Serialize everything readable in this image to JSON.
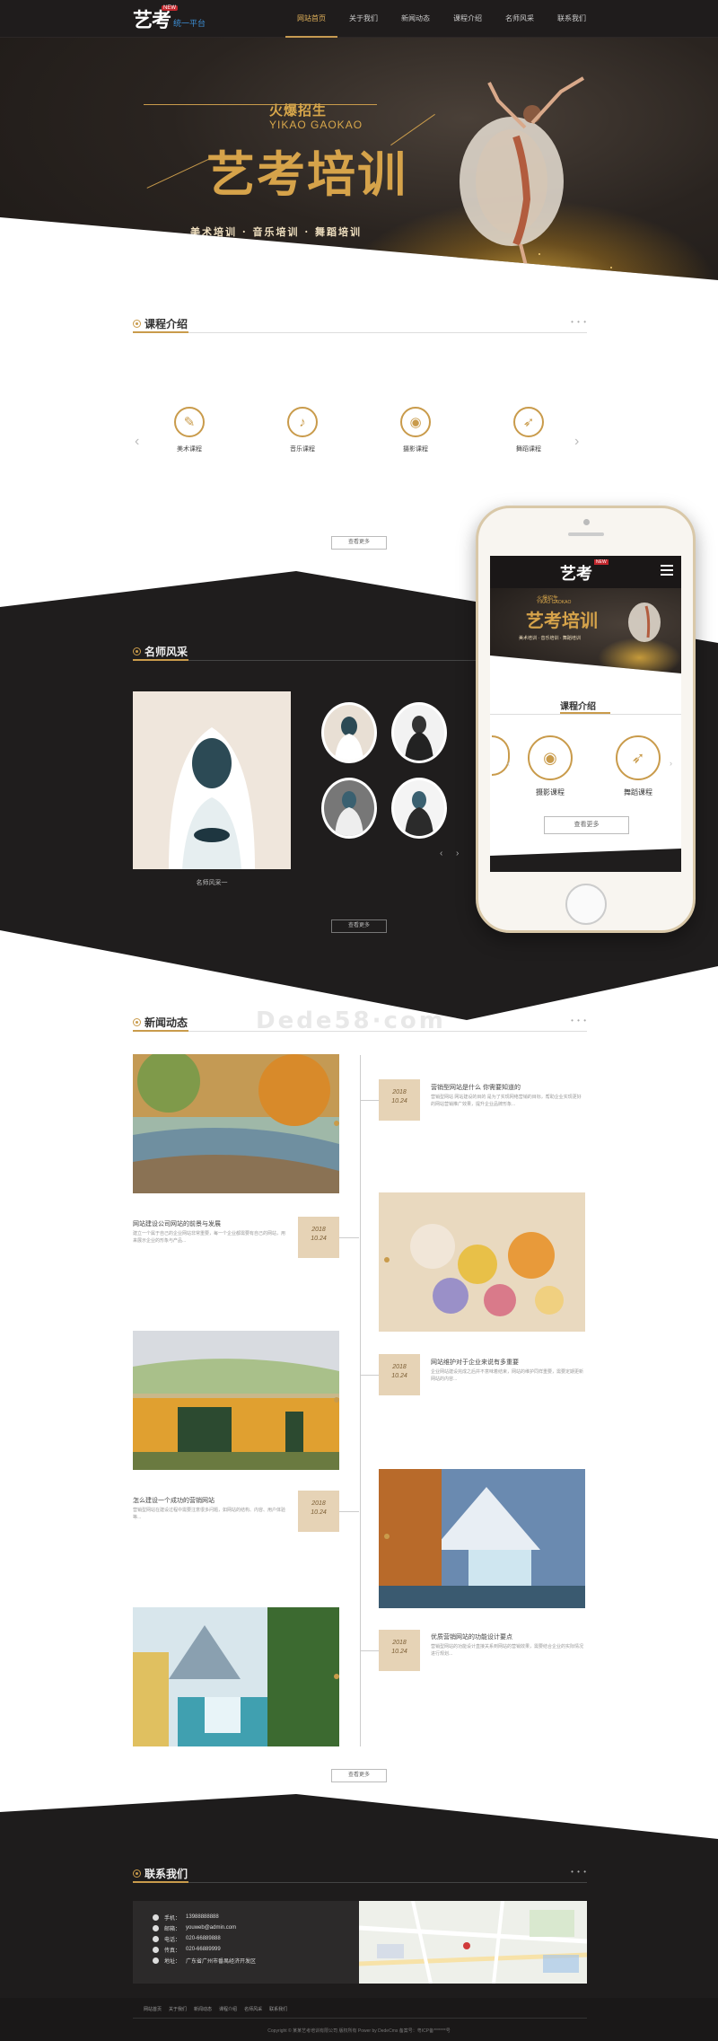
{
  "header": {
    "logo_main": "艺考",
    "logo_sub": "统一平台",
    "logo_badge": "NEW",
    "nav": [
      "网站首页",
      "关于我们",
      "新闻动态",
      "课程介绍",
      "名师风采",
      "联系我们"
    ]
  },
  "hero": {
    "sub_top": "火爆招生",
    "sub_en": "YIKAO GAOKAO",
    "title": "艺考培训",
    "tagline": "美术培训 · 音乐培训 · 舞蹈培训"
  },
  "courses": {
    "title": "课程介绍",
    "more_dots": "• • •",
    "items": [
      {
        "label": "美术课程",
        "icon": "brush-icon",
        "glyph": "✎"
      },
      {
        "label": "音乐课程",
        "icon": "music-note-icon",
        "glyph": "♪"
      },
      {
        "label": "摄影课程",
        "icon": "camera-icon",
        "glyph": "◉"
      },
      {
        "label": "舞蹈课程",
        "icon": "dance-icon",
        "glyph": "➶"
      }
    ],
    "prev": "‹",
    "next": "›",
    "more_button": "查看更多"
  },
  "teachers": {
    "title": "名师风采",
    "more_dots": "• • •",
    "main_caption": "名师风采一",
    "prev": "‹",
    "next": "›",
    "more_button": "查看更多"
  },
  "phone": {
    "logo_main": "艺考",
    "logo_badge": "NEW",
    "hero_sub_top": "火爆招生",
    "hero_sub_en": "YIKAO GAOKAO",
    "hero_title": "艺考培训",
    "hero_tagline": "美术培训 · 音乐培训 · 舞蹈培训",
    "section_title": "课程介绍",
    "courses": [
      "摄影课程",
      "舞蹈课程"
    ],
    "more_button": "查看更多"
  },
  "news": {
    "title": "新闻动态",
    "more_dots": "• • •",
    "items": [
      {
        "date_year": "2018",
        "date_day": "10.24",
        "title": "营销型网站是什么  你需要知道的",
        "desc": "营销型网站 网站建设的目的 是为了实现网络营销的目标，帮助企业实现更好的网站营销推广效果，提升企业品牌形象..."
      },
      {
        "date_year": "2018",
        "date_day": "10.24",
        "title": "网站建设公司网站的前景与发展",
        "desc": "建立一个属于自己的企业网站非常重要，每一个企业都需要有自己的网站，用来展示企业的形象与产品..."
      },
      {
        "date_year": "2018",
        "date_day": "10.24",
        "title": "网站维护对于企业来说有多重要",
        "desc": "企业网站建设完成之后并不意味着结束，网站的维护同样重要，需要定期更新网站的内容..."
      },
      {
        "date_year": "2018",
        "date_day": "10.24",
        "title": "怎么建设一个成功的营销网站",
        "desc": "营销型网站在建设过程中需要注意很多问题，如网站的结构、内容、用户体验等..."
      },
      {
        "date_year": "2018",
        "date_day": "10.24",
        "title": "优质营销网站的功能设计要点",
        "desc": "营销型网站的功能设计直接关系到网站的营销效果，需要结合企业的实际情况进行规划..."
      }
    ],
    "more_button": "查看更多"
  },
  "watermark": "Dede58·com",
  "contact": {
    "title": "联系我们",
    "more_dots": "• • •",
    "rows": [
      {
        "label": "手机：",
        "value": "13988888888",
        "icon": "phone-icon"
      },
      {
        "label": "邮箱：",
        "value": "youweb@admin.com",
        "icon": "mail-icon"
      },
      {
        "label": "电话：",
        "value": "020-66889888",
        "icon": "telephone-icon"
      },
      {
        "label": "传真：",
        "value": "020-66889999",
        "icon": "fax-icon"
      },
      {
        "label": "地址：",
        "value": "广东省广州市番禺经济开发区",
        "icon": "location-icon"
      }
    ]
  },
  "footer": {
    "links": [
      "网站首页",
      "关于我们",
      "新闻动态",
      "课程介绍",
      "名师风采",
      "联系我们"
    ],
    "copyright": "Copyright © 某某艺考培训有限公司 版权所有 Power by DedeCms 备案号：粤ICP备*******号"
  },
  "colors": {
    "accent": "#c99b4b",
    "dark": "#1f1d1d",
    "nav_active": "#e0b15a"
  }
}
